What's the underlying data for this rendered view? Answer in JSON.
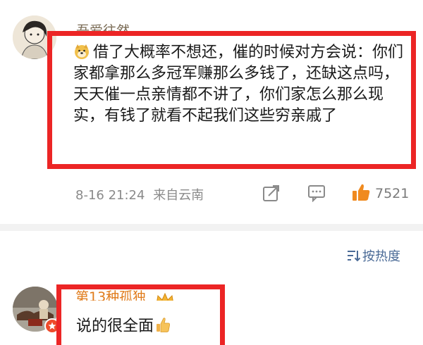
{
  "comment1": {
    "username": "吾爱往然",
    "text": "借了大概率不想还，催的时候对方会说：你们家都拿那么多冠军赚那么多钱了，还缺这点吗，天天催一点亲情都不讲了，你们家怎么那么现实，有钱了就看不起我们这些穷亲戚了",
    "time": "8-16 21:24",
    "location": "来自云南",
    "like_count": "7521",
    "emoji": "doge-emoji"
  },
  "sort": {
    "label": "按热度"
  },
  "comment2": {
    "username": "第13种孤独",
    "text": "说的很全面",
    "emoji": "thumbs-up-emoji"
  },
  "colors": {
    "highlight_box": "#ec2525",
    "vip_username": "#e07b1a",
    "link_blue": "#4a6a96",
    "like_orange": "#f08a1f"
  }
}
